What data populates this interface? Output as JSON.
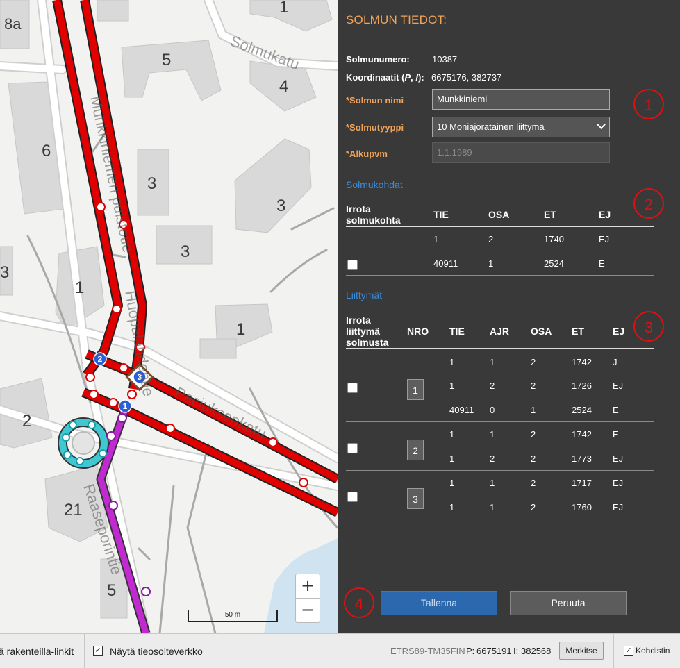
{
  "map": {
    "labels": [
      "8a",
      "1",
      "5",
      "4",
      "6",
      "3",
      "3",
      "3",
      "3",
      "1",
      "1",
      "2",
      "21",
      "5"
    ],
    "street_names": [
      "Solmukatu",
      "Munkkiniemen puistotie",
      "Raaseporintie",
      "Paciuksenkatu",
      "Huopalahdentie"
    ],
    "node_markers": [
      "2",
      "3",
      "1"
    ],
    "zoom_in": "+",
    "zoom_out": "−",
    "scale_label": "50 m"
  },
  "panel": {
    "title": "SOLMUN TIEDOT:",
    "solmunumero_label": "Solmunumero:",
    "solmunumero": "10387",
    "koordinaatit_label_a": "Koordinaatit (",
    "koordinaatit_label_p": "P",
    "koordinaatit_label_sep": ", ",
    "koordinaatit_label_i": "I",
    "koordinaatit_label_b": "):",
    "koordinaatit": "6675176, 382737",
    "nimi_label": "*Solmun nimi",
    "nimi": "Munkkiniemi",
    "tyyppi_label": "*Solmutyyppi",
    "tyyppi": "10 Moniajoratainen liittymä",
    "alkupvm_label": "*Alkupvm",
    "alkupvm": "1.1.1989",
    "solmukohdat": {
      "title": "Solmukohdat",
      "headers": [
        "Irrota solmukohta",
        "TIE",
        "OSA",
        "ET",
        "EJ"
      ],
      "rows": [
        {
          "tie": "1",
          "osa": "2",
          "et": "1740",
          "ej": "EJ",
          "checkbox": false
        },
        {
          "tie": "40911",
          "osa": "1",
          "et": "2524",
          "ej": "E",
          "checkbox": true
        }
      ]
    },
    "liittymat": {
      "title": "Liittymät",
      "headers": [
        "Irrota liittymä solmusta",
        "NRO",
        "TIE",
        "AJR",
        "OSA",
        "ET",
        "EJ"
      ],
      "groups": [
        {
          "nro": "1",
          "rows": [
            {
              "tie": "1",
              "ajr": "1",
              "osa": "2",
              "et": "1742",
              "ej": "J"
            },
            {
              "tie": "1",
              "ajr": "2",
              "osa": "2",
              "et": "1726",
              "ej": "EJ"
            },
            {
              "tie": "40911",
              "ajr": "0",
              "osa": "1",
              "et": "2524",
              "ej": "E"
            }
          ]
        },
        {
          "nro": "2",
          "rows": [
            {
              "tie": "1",
              "ajr": "1",
              "osa": "2",
              "et": "1742",
              "ej": "E"
            },
            {
              "tie": "1",
              "ajr": "2",
              "osa": "2",
              "et": "1773",
              "ej": "EJ"
            }
          ]
        },
        {
          "nro": "3",
          "rows": [
            {
              "tie": "1",
              "ajr": "1",
              "osa": "2",
              "et": "1717",
              "ej": "EJ"
            },
            {
              "tie": "1",
              "ajr": "1",
              "osa": "2",
              "et": "1760",
              "ej": "EJ"
            }
          ]
        }
      ]
    },
    "annotations": [
      "1",
      "2",
      "3",
      "4"
    ],
    "save": "Tallenna",
    "cancel": "Peruuta"
  },
  "bottom": {
    "left_text": "ä rakenteilla-linkit",
    "show_network": "Näytä tieosoiteverkko",
    "crs": "ETRS89-TM35FIN",
    "p_label": "P:",
    "p_value": "6675191",
    "i_label": "I:",
    "i_value": "382568",
    "merkitse": "Merkitse",
    "kohdistin": "Kohdistin"
  },
  "colors": {
    "panel_bg": "#393939",
    "orange": "#f0a45a",
    "link_blue": "#3b8dd9",
    "road_red": "#e00000",
    "save_blue": "#2b68ad",
    "annotation_red": "#d11111",
    "purple": "#c02ad0",
    "cyan": "#3fc8d2"
  }
}
